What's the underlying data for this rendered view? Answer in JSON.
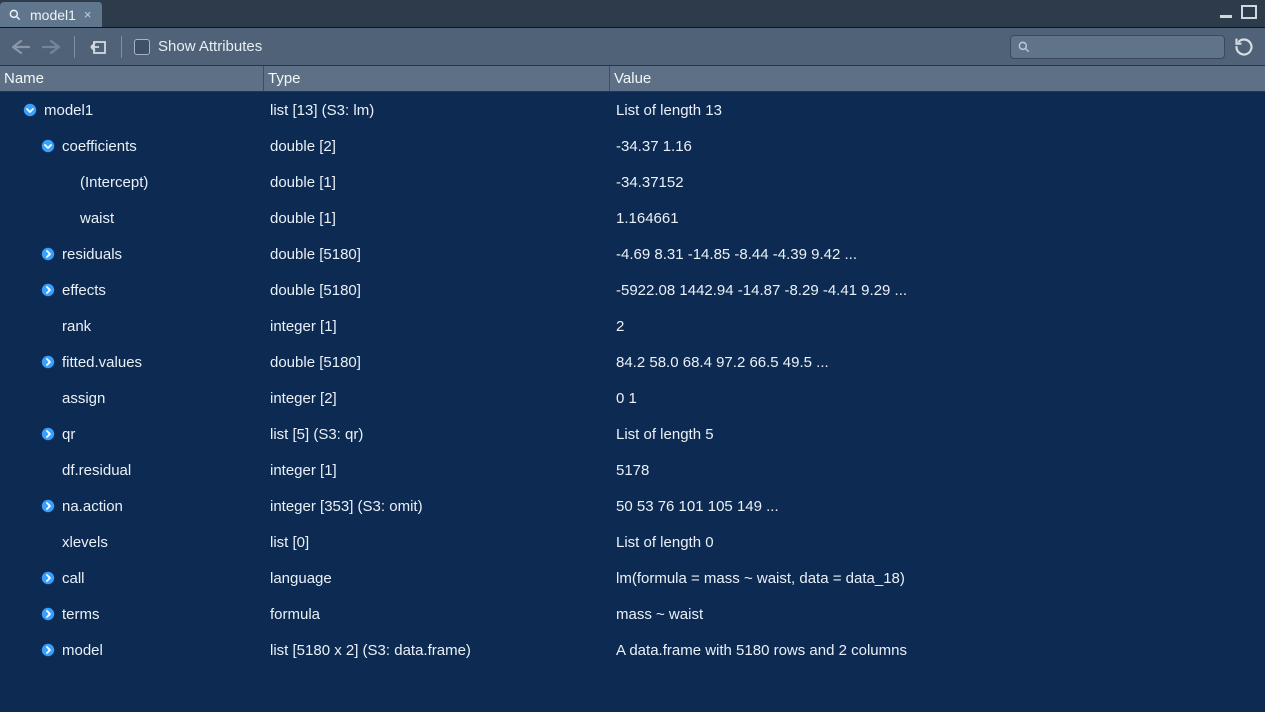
{
  "tab": {
    "title": "model1"
  },
  "toolbar": {
    "show_attributes_label": "Show Attributes",
    "search_placeholder": ""
  },
  "columns": {
    "name": "Name",
    "type": "Type",
    "value": "Value"
  },
  "rows": [
    {
      "depth": 0,
      "arrow": "down",
      "name": "model1",
      "type": "list [13] (S3: lm)",
      "value": "List of length 13"
    },
    {
      "depth": 1,
      "arrow": "down",
      "name": "coefficients",
      "type": "double [2]",
      "value": "-34.37 1.16"
    },
    {
      "depth": 2,
      "arrow": "none",
      "name": "(Intercept)",
      "type": "double [1]",
      "value": "-34.37152"
    },
    {
      "depth": 2,
      "arrow": "none",
      "name": "waist",
      "type": "double [1]",
      "value": "1.164661"
    },
    {
      "depth": 1,
      "arrow": "right",
      "name": "residuals",
      "type": "double [5180]",
      "value": "-4.69 8.31 -14.85 -8.44 -4.39 9.42 ..."
    },
    {
      "depth": 1,
      "arrow": "right",
      "name": "effects",
      "type": "double [5180]",
      "value": "-5922.08 1442.94 -14.87 -8.29 -4.41 9.29 ..."
    },
    {
      "depth": 1,
      "arrow": "none",
      "name": "rank",
      "type": "integer [1]",
      "value": "2"
    },
    {
      "depth": 1,
      "arrow": "right",
      "name": "fitted.values",
      "type": "double [5180]",
      "value": "84.2 58.0 68.4 97.2 66.5 49.5 ..."
    },
    {
      "depth": 1,
      "arrow": "none",
      "name": "assign",
      "type": "integer [2]",
      "value": "0 1"
    },
    {
      "depth": 1,
      "arrow": "right",
      "name": "qr",
      "type": "list [5] (S3: qr)",
      "value": "List of length 5"
    },
    {
      "depth": 1,
      "arrow": "none",
      "name": "df.residual",
      "type": "integer [1]",
      "value": "5178"
    },
    {
      "depth": 1,
      "arrow": "right",
      "name": "na.action",
      "type": "integer [353] (S3: omit)",
      "value": "50 53 76 101 105 149 ..."
    },
    {
      "depth": 1,
      "arrow": "none",
      "name": "xlevels",
      "type": "list [0]",
      "value": "List of length 0"
    },
    {
      "depth": 1,
      "arrow": "right",
      "name": "call",
      "type": "language",
      "value": "lm(formula = mass ~ waist, data = data_18)"
    },
    {
      "depth": 1,
      "arrow": "right",
      "name": "terms",
      "type": "formula",
      "value": "mass ~ waist"
    },
    {
      "depth": 1,
      "arrow": "right",
      "name": "model",
      "type": "list [5180 x 2] (S3: data.frame)",
      "value": "A data.frame with 5180 rows and 2 columns"
    }
  ]
}
